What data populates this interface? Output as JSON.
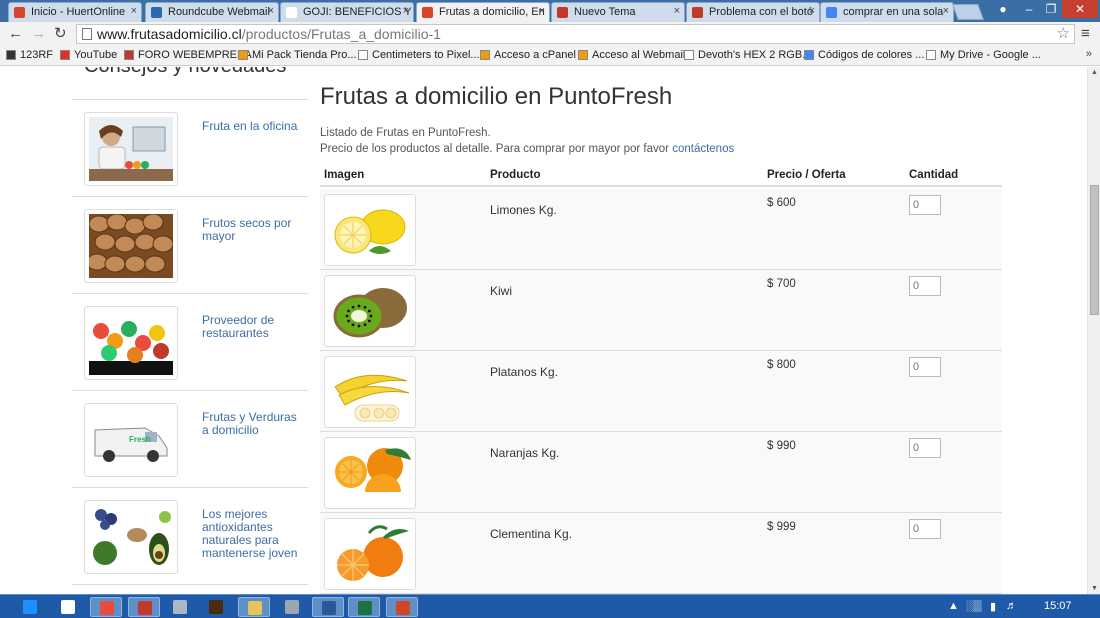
{
  "browser": {
    "tabs": [
      {
        "title": "Inicio - HuertOnline",
        "fav_color": "#d9442b",
        "active": false
      },
      {
        "title": "Roundcube Webmail",
        "fav_color": "#2a6ab0",
        "active": false
      },
      {
        "title": "GOJI: BENEFICIOS Y P",
        "fav_color": "#ffffff",
        "active": false
      },
      {
        "title": "Frutas a domicilio, En",
        "fav_color": "#d9442b",
        "active": true
      },
      {
        "title": "Nuevo Tema",
        "fav_color": "#c0392b",
        "active": false
      },
      {
        "title": "Problema con el botó",
        "fav_color": "#c0392b",
        "active": false
      },
      {
        "title": "comprar en una sola",
        "fav_color": "#4285f4",
        "active": false
      }
    ],
    "tab_close_glyph": "×",
    "url_host": "www.frutasadomicilio.cl",
    "url_path": "/productos/Frutas_a_domicilio-1",
    "bookmarks": [
      {
        "label": "123RF",
        "icon_color": "#333333"
      },
      {
        "label": "YouTube",
        "icon_color": "#e52d27"
      },
      {
        "label": "FORO WEBEMPRESA",
        "icon_color": "#c0392b"
      },
      {
        "label": "Mi Pack Tienda Pro...",
        "icon_color": "#f39c12"
      },
      {
        "label": "Centimeters to Pixel...",
        "icon_color": "#ffffff"
      },
      {
        "label": "Acceso a cPanel",
        "icon_color": "#f39c12"
      },
      {
        "label": "Acceso al Webmail",
        "icon_color": "#f39c12"
      },
      {
        "label": "Devoth's HEX 2 RGB...",
        "icon_color": "#ffffff"
      },
      {
        "label": "Códigos de colores ...",
        "icon_color": "#4285f4"
      },
      {
        "label": "My Drive - Google ...",
        "icon_color": "#ffffff"
      }
    ],
    "bookmarks_more": "»"
  },
  "sidebar": {
    "title": "Consejos y novedades",
    "items": [
      {
        "label": "Fruta en la oficina",
        "img": "office"
      },
      {
        "label": "Frutos secos por mayor",
        "img": "nuts"
      },
      {
        "label": "Proveedor de restaurantes",
        "img": "salad"
      },
      {
        "label": "Frutas y Verduras a domicilio",
        "img": "van"
      },
      {
        "label": "Los mejores antioxidantes naturales para mantenerse joven",
        "img": "antiox"
      }
    ]
  },
  "main": {
    "title": "Frutas a domicilio en PuntoFresh",
    "intro_line1": "Listado de Frutas en PuntoFresh.",
    "intro_line2": "Precio de los productos al detalle. Para comprar por mayor por favor",
    "contact_link": "contáctenos",
    "columns": {
      "image": "Imagen",
      "product": "Producto",
      "price": "Precio / Oferta",
      "qty": "Cantidad"
    },
    "products": [
      {
        "name": "Limones Kg.",
        "price": "$ 600",
        "qty_placeholder": "0",
        "img": "lemon"
      },
      {
        "name": "Kiwi",
        "price": "$ 700",
        "qty_placeholder": "0",
        "img": "kiwi"
      },
      {
        "name": "Platanos Kg.",
        "price": "$ 800",
        "qty_placeholder": "0",
        "img": "banana"
      },
      {
        "name": "Naranjas Kg.",
        "price": "$ 990",
        "qty_placeholder": "0",
        "img": "orange"
      },
      {
        "name": "Clementina Kg.",
        "price": "$ 999",
        "qty_placeholder": "0",
        "img": "clementine"
      }
    ]
  },
  "taskbar": {
    "apps": [
      "ie-icon",
      "hp-icon",
      "chrome-icon",
      "image-viewer-icon",
      "network-icon",
      "illustrator-icon",
      "file-explorer-icon",
      "calculator-icon",
      "word-icon",
      "excel-icon",
      "powerpoint-icon"
    ],
    "clock": "15:07"
  }
}
